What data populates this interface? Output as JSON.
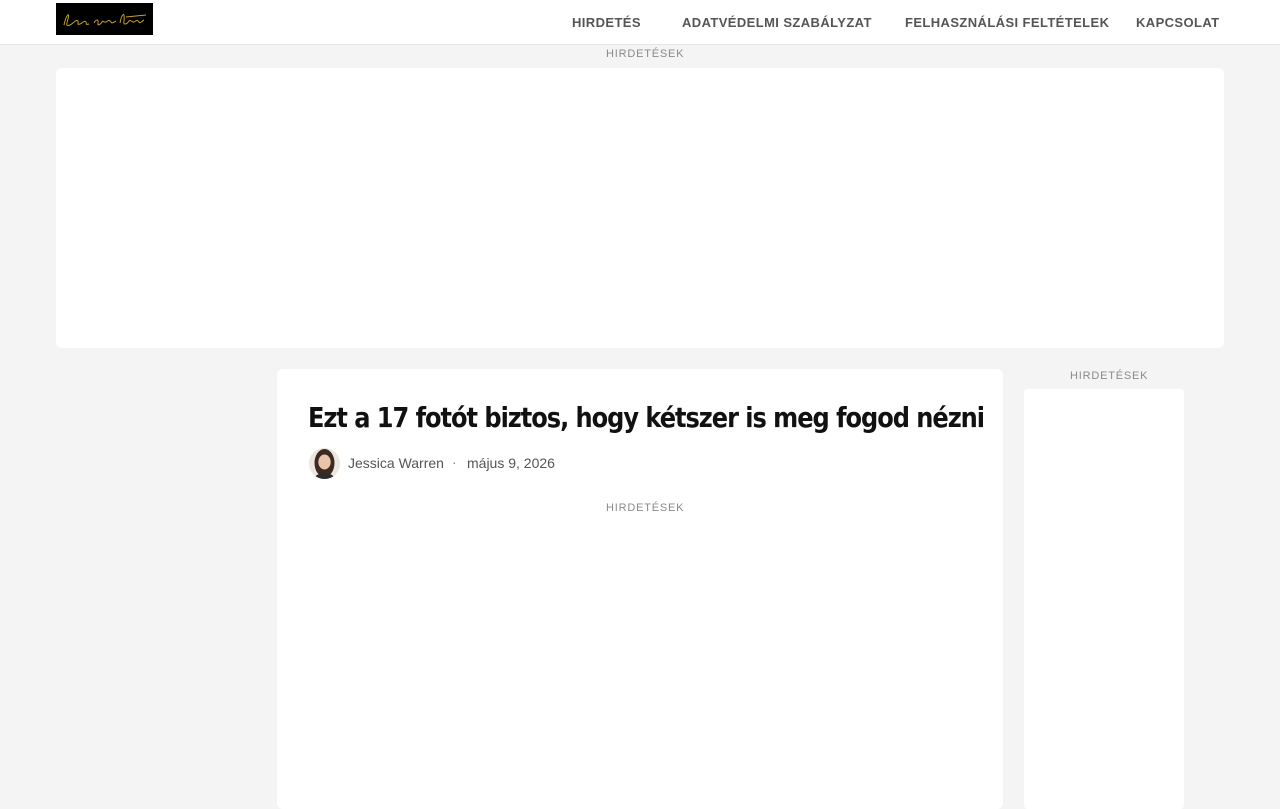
{
  "header": {
    "logo_alt": "Love your desires",
    "nav": [
      {
        "label": "HIRDETÉS"
      },
      {
        "label": "ADATVÉDELMI SZABÁLYZAT"
      },
      {
        "label": "FELHASZNÁLÁSI FELTÉTELEK"
      },
      {
        "label": "KAPCSOLAT"
      }
    ]
  },
  "ads": {
    "top_label": "HIRDETÉSEK",
    "sidebar_label": "HIRDETÉSEK",
    "inline_label": "HIRDETÉSEK"
  },
  "article": {
    "title": "Ezt a 17 fotót biztos, hogy kétszer is meg fogod nézni",
    "author": "Jessica Warren",
    "separator": "·",
    "date": "május 9, 2026"
  },
  "colors": {
    "page_bg": "#f4f4f4",
    "card_bg": "#ffffff",
    "nav_text": "#555555",
    "title_text": "#111111",
    "logo_bg": "#000000",
    "logo_gold": "#c9a227"
  }
}
